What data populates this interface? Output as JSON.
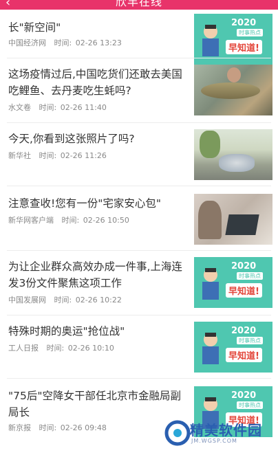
{
  "header": {
    "title": "欣丰在线",
    "back_icon": "chevron-left-icon",
    "bg": "#e8336a"
  },
  "articles": [
    {
      "title": "长\"新空间\"",
      "source": "中国经济网",
      "time_label": "时间:",
      "time": "02-26 13:23",
      "thumb": "promo"
    },
    {
      "title": "这场疫情过后,中国吃货们还敢去美国吃鲤鱼、去丹麦吃生蚝吗?",
      "source": "水文卷",
      "time_label": "时间:",
      "time": "02-26 11:40",
      "thumb": "photo"
    },
    {
      "title": "今天,你看到这张照片了吗?",
      "source": "新华社",
      "time_label": "时间:",
      "time": "02-26 11:26",
      "thumb": "photo"
    },
    {
      "title": "注意查收!您有一份\"宅家安心包\"",
      "source": "新华网客户端",
      "time_label": "时间:",
      "time": "02-26 10:50",
      "thumb": "photo"
    },
    {
      "title": "为让企业群众高效办成一件事,上海连发3份文件聚焦这项工作",
      "source": "中国发展网",
      "time_label": "时间:",
      "time": "02-26 10:22",
      "thumb": "promo"
    },
    {
      "title": "特殊时期的奥运\"抢位战\"",
      "source": "工人日报",
      "time_label": "时间:",
      "time": "02-26 10:10",
      "thumb": "promo"
    },
    {
      "title": "\"75后\"空降女干部任北京市金融局副局长",
      "source": "新京报",
      "time_label": "时间:",
      "time": "02-26 09:48",
      "thumb": "promo"
    }
  ],
  "promo": {
    "year": "2020",
    "tag": "时事热点",
    "slogan": "早知道!"
  },
  "watermark": {
    "name": "精美软件园",
    "url": "JM.WGSP.COM"
  }
}
